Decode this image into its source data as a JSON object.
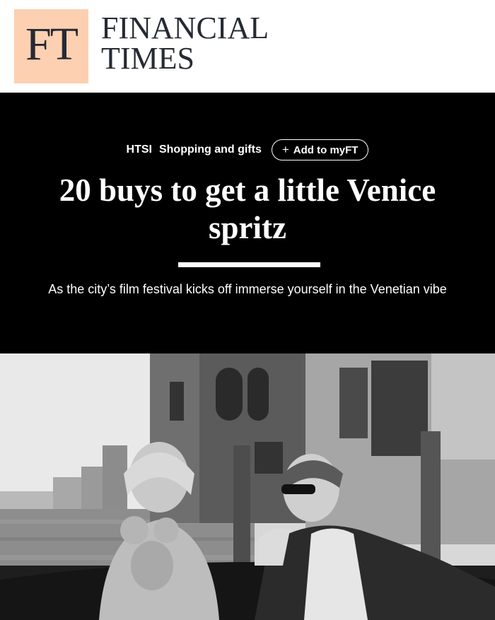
{
  "masthead": {
    "logo_text": "FT",
    "wordmark_line1": "FINANCIAL",
    "wordmark_line2": "TIMES",
    "logo_color": "#fcd0b1"
  },
  "article": {
    "topics": [
      "HTSI",
      "Shopping and gifts"
    ],
    "myft_button": "Add to myFT",
    "myft_icon": "plus-icon",
    "headline": "20 buys to get a little Venice spritz",
    "standfirst": "As the city’s film festival kicks off immerse yourself in the Venetian vibe"
  },
  "image": {
    "description": "black-and-white-photo-venice-boat-couple"
  }
}
